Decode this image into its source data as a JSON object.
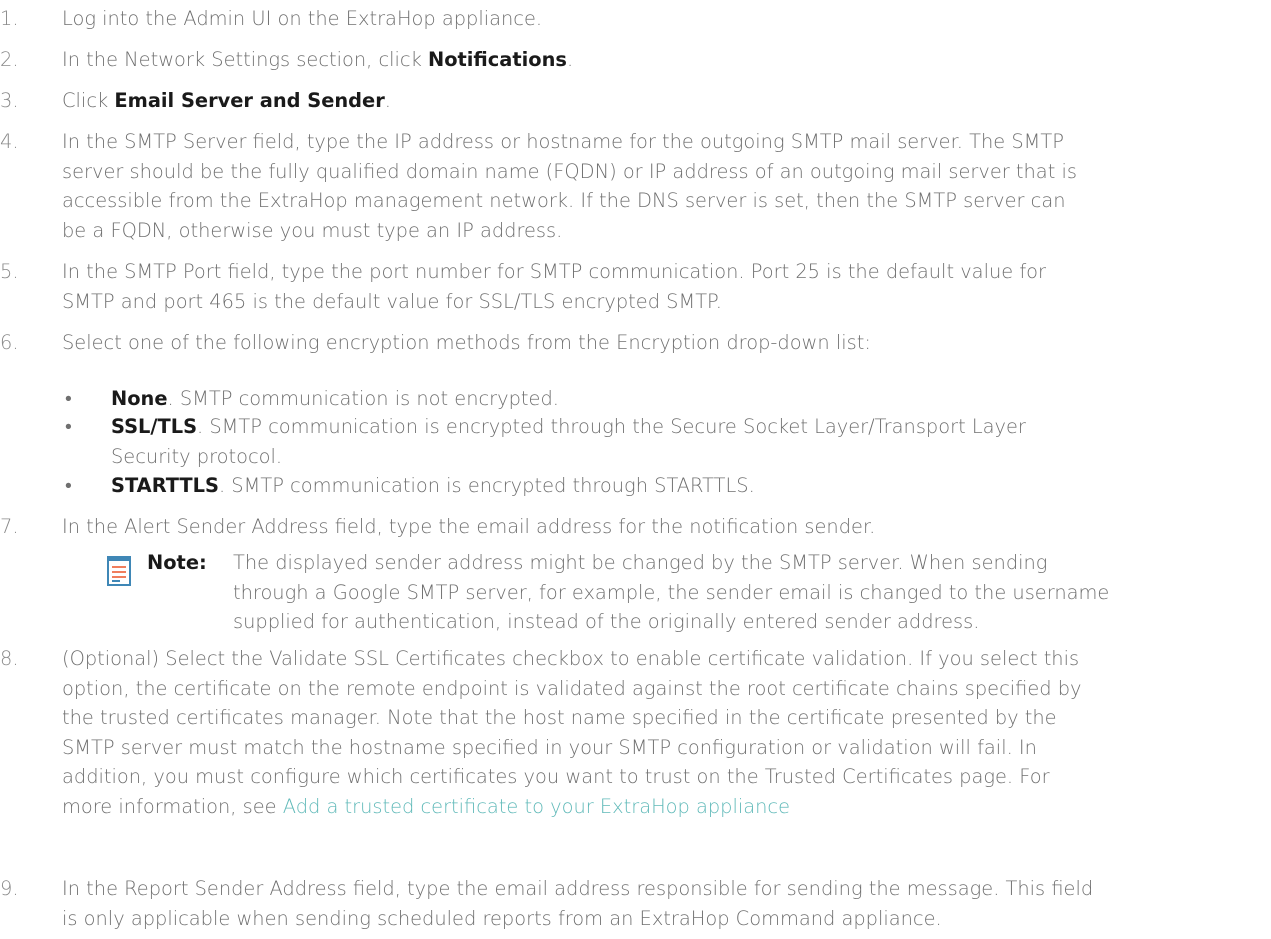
{
  "steps": {
    "s1": {
      "num": "1.",
      "text": "Log into the Admin UI on the ExtraHop appliance."
    },
    "s2": {
      "num": "2.",
      "pre": "In the Network Settings section, click ",
      "strong": "Notifications",
      "post": "."
    },
    "s3": {
      "num": "3.",
      "pre": "Click ",
      "strong": "Email Server and Sender",
      "post": "."
    },
    "s4": {
      "num": "4.",
      "lines": [
        "In the SMTP Server field, type the IP address or hostname for the outgoing SMTP mail server. The SMTP",
        "server should be the fully qualified domain name (FQDN) or IP address of an outgoing mail server that is",
        "accessible from the ExtraHop management network. If the DNS server is set, then the SMTP server can",
        "be a FQDN, otherwise you must type an IP address."
      ]
    },
    "s5": {
      "num": "5.",
      "lines": [
        "In the SMTP Port field, type the port number for SMTP communication. Port 25 is the default value for",
        "SMTP and port 465 is the default value for SSL/TLS encrypted SMTP."
      ]
    },
    "s6": {
      "num": "6.",
      "text": "Select one of the following encryption methods from the Encryption drop-down list:",
      "options": [
        {
          "bullet": "•",
          "strong": "None",
          "post": ". SMTP communication is not encrypted."
        },
        {
          "bullet": "•",
          "strong": "SSL/TLS",
          "post": ". SMTP communication is encrypted through the Secure Socket Layer/Transport Layer",
          "post2": "Security protocol."
        },
        {
          "bullet": "•",
          "strong": "STARTTLS",
          "post": ". SMTP communication is encrypted through STARTTLS."
        }
      ]
    },
    "s7": {
      "num": "7.",
      "text": "In the Alert Sender Address field, type the email address for the notification sender.",
      "note": {
        "label": "Note:",
        "lines": [
          "The displayed sender address might be changed by the SMTP server. When sending",
          "through a Google SMTP server, for example, the sender email is changed to the username",
          "supplied for authentication, instead of the originally entered sender address."
        ]
      }
    },
    "s8": {
      "num": "8.",
      "lines": [
        "(Optional) Select the Validate SSL Certificates checkbox to enable certificate validation. If you select this",
        "option, the certificate on the remote endpoint is validated against the root certificate chains specified by",
        "the trusted certificates manager. Note that the host name specified in the certificate presented by the",
        "SMTP server must match the hostname specified in your SMTP configuration or validation will fail. In",
        "addition, you must configure which certificates you want to trust on the Trusted Certificates page. For"
      ],
      "last_pre": "more information, see ",
      "link": "Add a trusted certificate to your ExtraHop appliance"
    },
    "s9": {
      "num": "9.",
      "lines": [
        "In the Report Sender Address field, type the email address responsible for sending the message. This field",
        "is only applicable when sending scheduled reports from an ExtraHop Command appliance."
      ]
    }
  },
  "colors": {
    "text": "#6f6f6f",
    "strong": "#1a1a1a",
    "link": "#5fb9b8",
    "note_icon_frame": "#3f87b6",
    "note_icon_lines": "#f07e5d"
  },
  "icons": {
    "note": "note-icon"
  }
}
